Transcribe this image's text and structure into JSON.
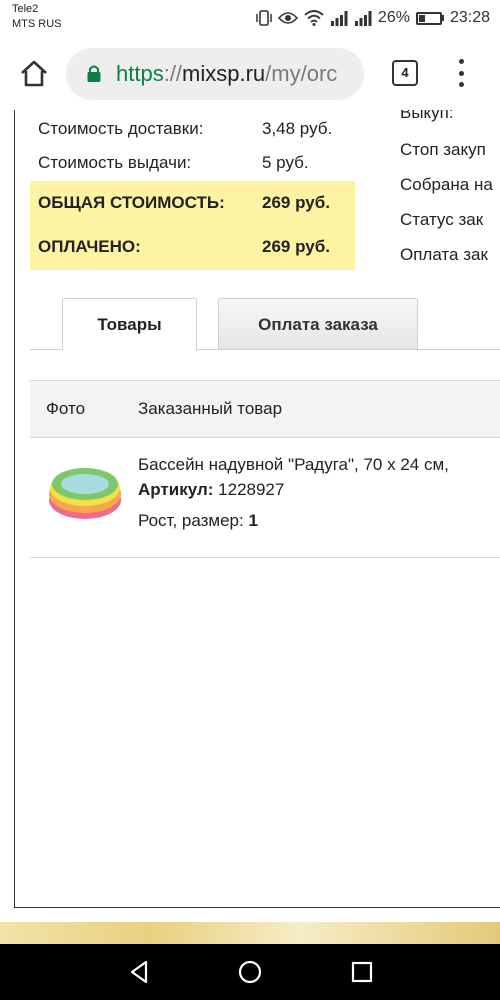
{
  "status_bar": {
    "carrier_1": "Tele2",
    "carrier_2": "MTS RUS",
    "battery": "26%",
    "time": "23:28"
  },
  "browser": {
    "url_scheme": "https",
    "url_sep": "://",
    "url_host": "mixsp.ru",
    "url_path": "/my/orc",
    "tab_count": "4"
  },
  "summary": {
    "delivery_label": "Стоимость доставки:",
    "delivery_value": "3,48 руб.",
    "issue_label": "Стоимость выдачи:",
    "issue_value": "5 руб.",
    "total_label": "ОБЩАЯ СТОИМОСТЬ:",
    "total_value": "269 руб.",
    "paid_label": "ОПЛАЧЕНО:",
    "paid_value": "269 руб.",
    "highlight_color": "#fcf3a3"
  },
  "right_column": [
    "Выкуп:",
    "Стоп закуп",
    "Собрана на",
    "Статус зак",
    "Оплата зак"
  ],
  "tabs": [
    {
      "label": "Товары",
      "active": true
    },
    {
      "label": "Оплата заказа",
      "active": false
    }
  ],
  "table": {
    "headers": [
      "Фото",
      "Заказанный товар"
    ],
    "rows": [
      {
        "photo_icon": "inflatable-pool-image",
        "name": "Бассейн надувной \"Радуга\", 70 x 24 см,",
        "article_label": "Артикул:",
        "article_value": "1228927",
        "size_label": "Рост, размер:",
        "size_value": "1"
      }
    ]
  },
  "nav": {
    "icons": [
      "back-icon",
      "home-icon",
      "recents-icon"
    ]
  },
  "colors": {
    "https_green": "#0b8043",
    "nav_bg": "#000000"
  }
}
